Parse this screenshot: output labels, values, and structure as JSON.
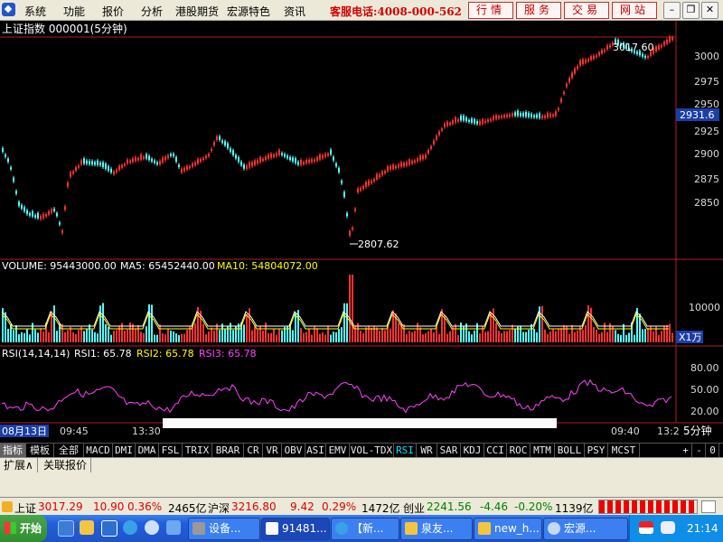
{
  "menubar": {
    "items": [
      "系统",
      "功能",
      "报价",
      "分析",
      "港股期货",
      "宏源特色",
      "资讯"
    ],
    "hotline": "客服电话:4008-000-562",
    "quick_buttons": [
      "行情",
      "服务",
      "交易",
      "网站"
    ]
  },
  "chart": {
    "title": "上证指数 000001(5分钟)",
    "price_ticks": [
      "3000",
      "2975",
      "2950",
      "2925",
      "2900",
      "2875",
      "2850"
    ],
    "current_price": "2931.6",
    "high_label": "3017.60",
    "low_label": "2807.62",
    "volume": {
      "label": "VOLUME: 95443000.00",
      "ma5": "MA5: 65452440.00",
      "ma10": "MA10: 54804072.00",
      "tick": "10000",
      "unit": "X1万"
    },
    "rsi": {
      "label": "RSI(14,14,14)",
      "rsi1": "RSI1: 65.78",
      "rsi2": "RSI2: 65.78",
      "rsi3": "RSI3: 65.78",
      "ticks": [
        "80.00",
        "50.00",
        "20.00"
      ]
    },
    "time_labels": [
      "08月13日",
      "09:45",
      "13:30",
      "09:40",
      "13:2"
    ],
    "period": "5分钟"
  },
  "tabs": [
    "指标",
    "模板",
    "全部",
    "MACD",
    "DMI",
    "DMA",
    "FSL",
    "TRIX",
    "BRAR",
    "CR",
    "VR",
    "OBV",
    "ASI",
    "EMV",
    "VOL-TDX",
    "RSI",
    "WR",
    "SAR",
    "KDJ",
    "CCI",
    "ROC",
    "MTM",
    "BOLL",
    "PSY",
    "MCST"
  ],
  "tab_controls": [
    "+",
    "-",
    "0"
  ],
  "ext_tabs": [
    "扩展∧",
    "关联报价"
  ],
  "status": {
    "sh_name": "上证",
    "sh_value": "3017.29",
    "sh_change": "10.90",
    "sh_pct": "0.36%",
    "sh_amount": "2465亿",
    "hs_name": "沪深",
    "hs_value": "3216.80",
    "hs_change": "9.42",
    "hs_pct": "0.29%",
    "hs_amount": "1472亿",
    "cy_name": "创业",
    "cy_value": "2241.56",
    "cy_change": "-4.46",
    "cy_pct": "-0.20%",
    "cy_amount": "1139亿"
  },
  "taskbar": {
    "start": "开始",
    "tasks": [
      "设备...",
      "91481...",
      "【新...",
      "泉友...",
      "new_h...",
      "宏源..."
    ],
    "clock": "21:14"
  },
  "colors": {
    "up": "#ff3232",
    "down": "#54ffff",
    "rsi": "#ff40ff",
    "ma5": "#ffffff",
    "ma10": "#ffff00",
    "accent": "#00e0ff"
  }
}
